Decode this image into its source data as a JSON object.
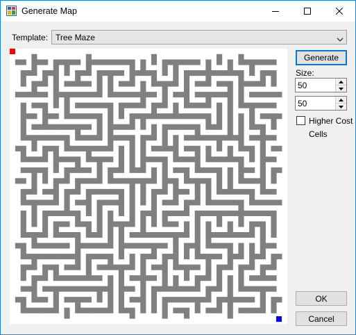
{
  "window": {
    "title": "Generate Map",
    "icon": "app-grid-icon"
  },
  "template": {
    "label": "Template:",
    "selected": "Tree Maze"
  },
  "buttons": {
    "generate": "Generate",
    "ok": "OK",
    "cancel": "Cancel"
  },
  "size": {
    "label": "Size:",
    "width": "50",
    "height": "50"
  },
  "higher_cost": {
    "label_line1": "Higher Cost",
    "label_line2": "Cells",
    "checked": false
  },
  "maze": {
    "start_color": "#ff0000",
    "end_color": "#0000ff",
    "wall_color": "#808080"
  }
}
